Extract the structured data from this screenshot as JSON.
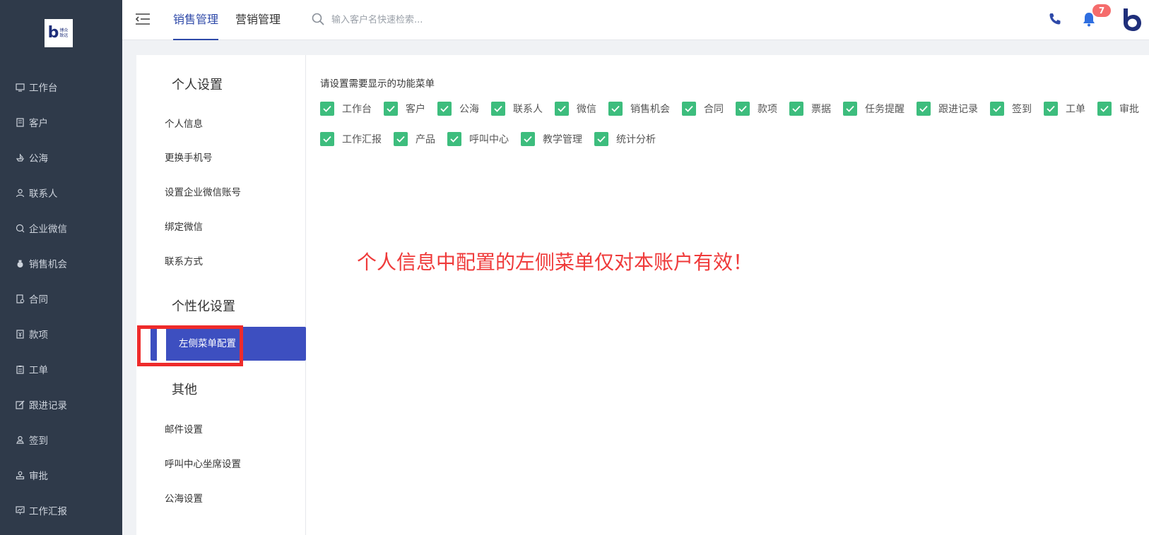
{
  "logo": {
    "text": "博众致远",
    "letter": "b"
  },
  "sidebar": {
    "items": [
      {
        "label": "工作台",
        "icon": "monitor-icon"
      },
      {
        "label": "客户",
        "icon": "building-icon"
      },
      {
        "label": "公海",
        "icon": "ship-icon"
      },
      {
        "label": "联系人",
        "icon": "user-icon"
      },
      {
        "label": "企业微信",
        "icon": "chat-icon"
      },
      {
        "label": "销售机会",
        "icon": "moneybag-icon"
      },
      {
        "label": "合同",
        "icon": "contract-icon"
      },
      {
        "label": "款项",
        "icon": "payment-icon"
      },
      {
        "label": "工单",
        "icon": "clipboard-icon"
      },
      {
        "label": "跟进记录",
        "icon": "edit-icon"
      },
      {
        "label": "签到",
        "icon": "checkin-icon"
      },
      {
        "label": "审批",
        "icon": "stamp-icon"
      },
      {
        "label": "工作汇报",
        "icon": "report-icon"
      }
    ]
  },
  "header": {
    "tabs": [
      {
        "label": "销售管理",
        "active": true
      },
      {
        "label": "营销管理",
        "active": false
      }
    ],
    "search": {
      "placeholder": "输入客户名快速检索..."
    },
    "notification_count": "7",
    "accent_color": "#2e49a8"
  },
  "settings_nav": {
    "sections": [
      {
        "title": "个人设置",
        "items": [
          "个人信息",
          "更换手机号",
          "设置企业微信账号",
          "绑定微信",
          "联系方式"
        ]
      },
      {
        "title": "个性化设置",
        "items": [
          "左侧菜单配置"
        ]
      },
      {
        "title": "其他",
        "items": [
          "邮件设置",
          "呼叫中心坐席设置",
          "公海设置"
        ]
      }
    ],
    "active_item": "左侧菜单配置"
  },
  "main": {
    "instruction": "请设置需要显示的功能菜单",
    "menu_options_row1": [
      "工作台",
      "客户",
      "公海",
      "联系人",
      "微信",
      "销售机会",
      "合同",
      "款项",
      "票据",
      "任务提醒",
      "跟进记录",
      "签到",
      "工单",
      "审批"
    ],
    "menu_options_row2": [
      "工作汇报",
      "产品",
      "呼叫中心",
      "教学管理",
      "统计分析"
    ],
    "all_checked": true,
    "check_color": "#3dbd7d",
    "notice": "个人信息中配置的左侧菜单仅对本账户有效！",
    "notice_color": "#ef3a3a"
  }
}
